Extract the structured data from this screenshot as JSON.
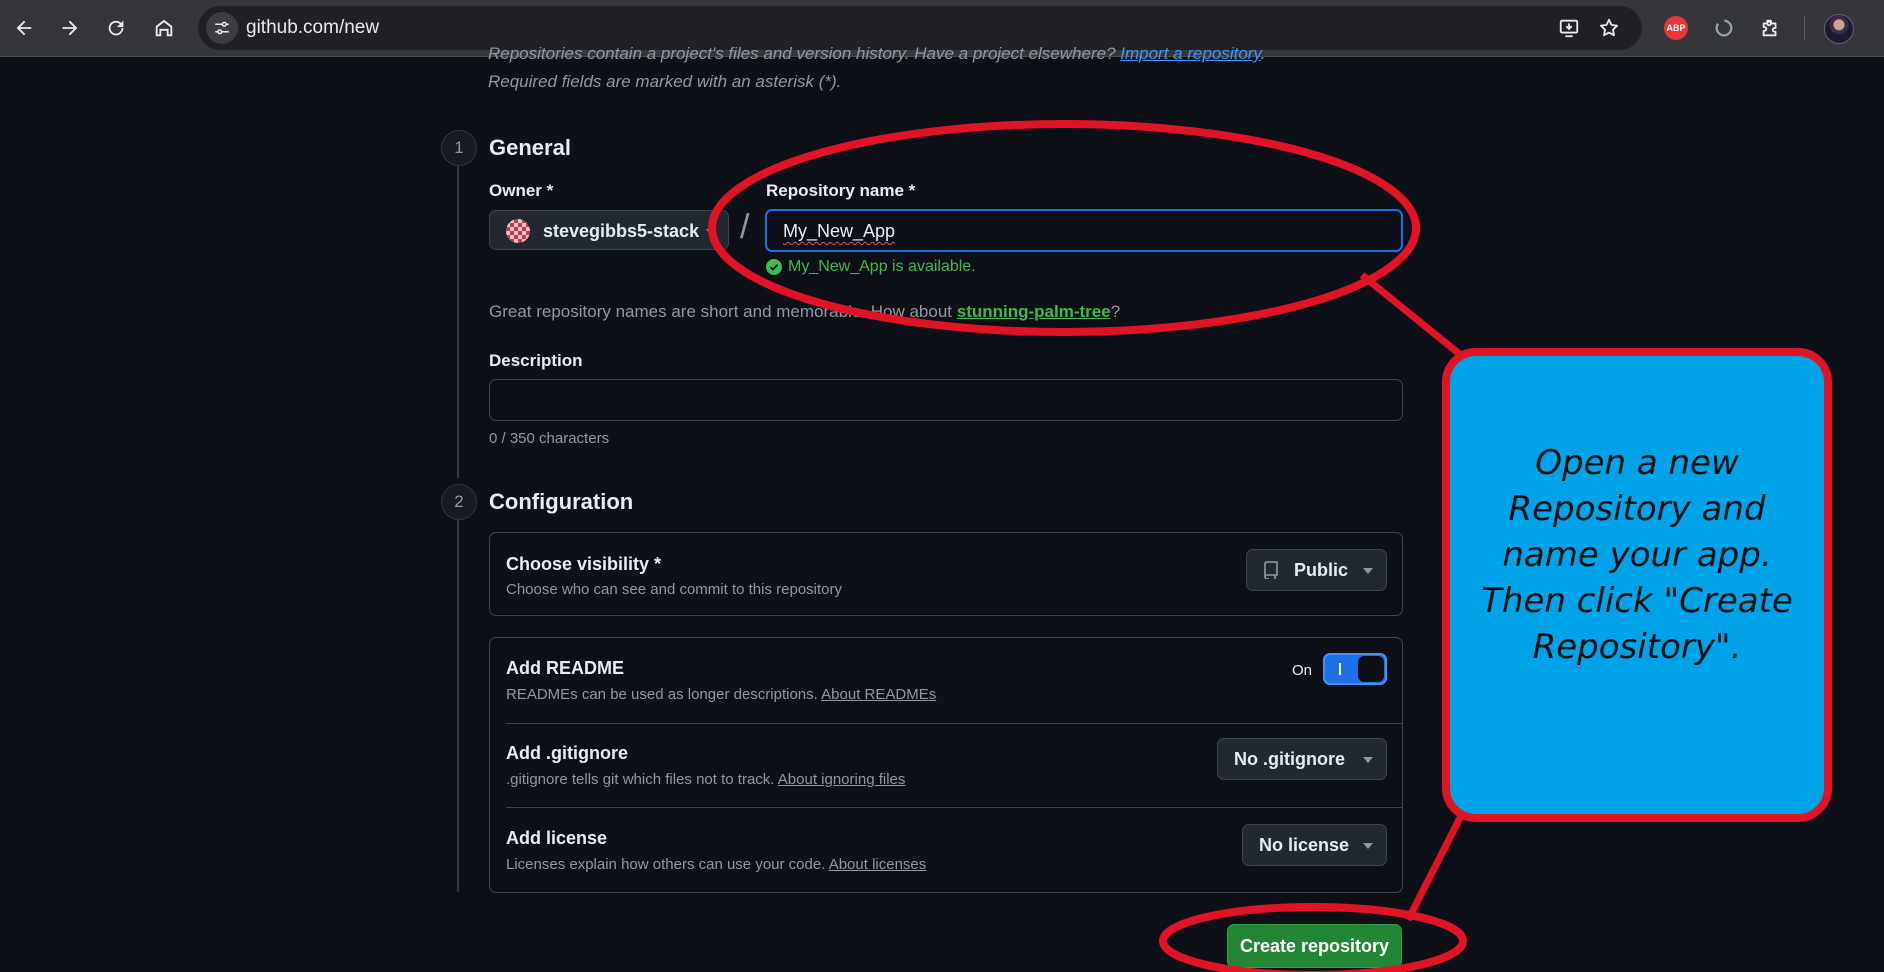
{
  "browser": {
    "url": "github.com/new",
    "extension_abp_label": "ABP",
    "icons": [
      "back-icon",
      "forward-icon",
      "reload-icon",
      "home-icon",
      "site-info-icon",
      "install-icon",
      "star-icon",
      "adblock-icon",
      "sync-icon",
      "extensions-icon"
    ]
  },
  "intro": {
    "text_prefix": "Repositories contain a project's files and version history. Have a project elsewhere? ",
    "import_link": "Import a repository",
    "text_suffix": ".",
    "required_note": "Required fields are marked with an asterisk (*)."
  },
  "general": {
    "step": "1",
    "heading": "General",
    "owner_label": "Owner *",
    "owner_value": "stevegibbs5-stack",
    "separator": "/",
    "repo_label": "Repository name *",
    "repo_value": "My_New_App",
    "availability": "My_New_App is available.",
    "hint_prefix": "Great repository names are short and memorable. How about ",
    "hint_suggestion": "stunning-palm-tree",
    "hint_suffix": "?",
    "description_label": "Description",
    "description_value": "",
    "char_counter": "0 / 350 characters"
  },
  "configuration": {
    "step": "2",
    "heading": "Configuration",
    "visibility": {
      "title": "Choose visibility *",
      "desc": "Choose who can see and commit to this repository",
      "selected": "Public"
    },
    "readme": {
      "title": "Add README",
      "desc": "READMEs can be used as longer descriptions. ",
      "link": "About READMEs",
      "toggle_label": "On",
      "toggle_state": true
    },
    "gitignore": {
      "title": "Add .gitignore",
      "desc": ".gitignore tells git which files not to track. ",
      "link": "About ignoring files",
      "selected": "No .gitignore"
    },
    "license": {
      "title": "Add license",
      "desc": "Licenses explain how others can use your code. ",
      "link": "About licenses",
      "selected": "No license"
    }
  },
  "create_button": "Create repository",
  "annotation": {
    "callout_text": "Open a new Repository and name your app. Then click \"Create Repository\".",
    "color_fill": "#00a3e8",
    "color_outline": "#e01424"
  },
  "colors": {
    "page_bg": "#0d1117",
    "accent_blue": "#1f6feb",
    "success_green": "#3fb950",
    "button_green": "#238636"
  }
}
